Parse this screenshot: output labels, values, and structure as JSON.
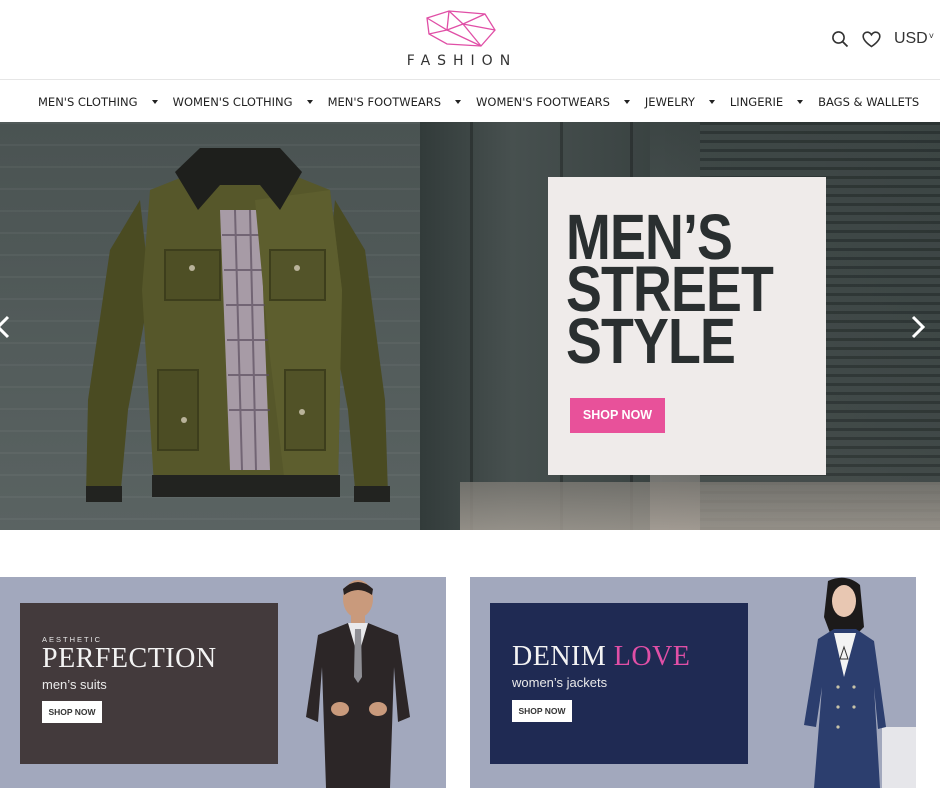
{
  "brand": {
    "name": "FASHION",
    "logo_icon": "diamond-logo-icon",
    "logo_color": "#e04fa6"
  },
  "header": {
    "search_icon": "search-icon",
    "wishlist_icon": "heart-icon",
    "currency": "USD"
  },
  "nav": {
    "items": [
      {
        "label": "MEN'S CLOTHING",
        "has_dropdown": true
      },
      {
        "label": "WOMEN'S CLOTHING",
        "has_dropdown": true
      },
      {
        "label": "MEN'S FOOTWEARS",
        "has_dropdown": true
      },
      {
        "label": "WOMEN'S FOOTWEARS",
        "has_dropdown": true
      },
      {
        "label": "JEWELRY",
        "has_dropdown": true
      },
      {
        "label": "LINGERIE",
        "has_dropdown": true
      },
      {
        "label": "BAGS & WALLETS",
        "has_dropdown": false
      }
    ]
  },
  "hero": {
    "headline_lines": [
      "MEN’S",
      "STREET",
      "STYLE"
    ],
    "cta_label": "SHOP NOW",
    "cta_color": "#e8519a",
    "prev_icon": "chevron-left-icon",
    "next_icon": "chevron-right-icon",
    "image": "olive-jacket-photo"
  },
  "banners": [
    {
      "kicker": "AESTHETIC",
      "title": "PERFECTION",
      "subtitle": "men’s suits",
      "cta_label": "SHOP NOW",
      "card_color": "#433a3c",
      "image": "man-in-suit-photo"
    },
    {
      "title_main": "DENIM",
      "title_accent": "LOVE",
      "subtitle": "women’s jackets",
      "cta_label": "SHOP NOW",
      "card_color": "#1f2a53",
      "accent_color": "#e04fa6",
      "image": "woman-denim-jacket-photo"
    }
  ]
}
